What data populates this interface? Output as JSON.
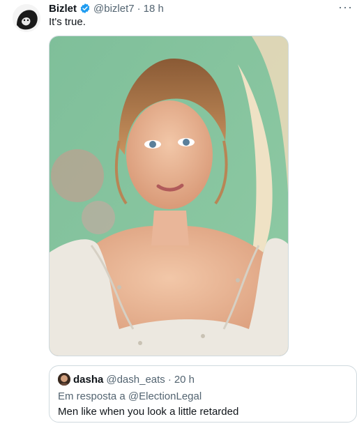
{
  "tweet": {
    "author_name": "Bizlet",
    "author_handle": "@bizlet7",
    "separator": "·",
    "time": "18 h",
    "text": "It's true.",
    "more_icon": "more-dots-icon",
    "verified_color": "#1d9bf0"
  },
  "quoted_tweet": {
    "author_name": "dasha",
    "author_handle": "@dash_eats",
    "separator": "·",
    "time": "20 h",
    "reply_prefix": "Em resposta a",
    "reply_to": "@ElectionLegal",
    "text": "Men like when you look a little retarded"
  },
  "colors": {
    "text_primary": "#0f1419",
    "text_secondary": "#536471",
    "border": "#cfd9de",
    "verified": "#1d9bf0"
  }
}
